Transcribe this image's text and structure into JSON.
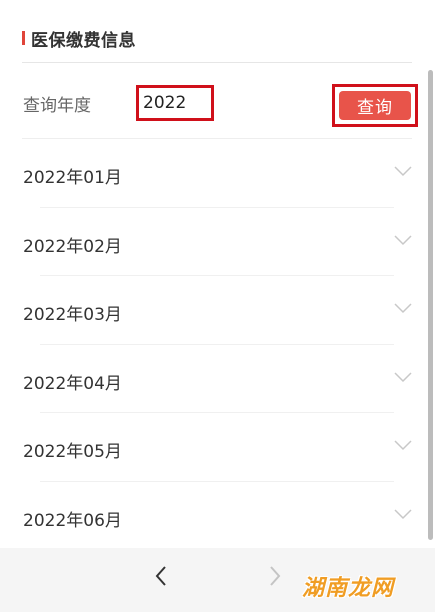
{
  "section": {
    "title": "医保缴费信息",
    "accent_color": "#e0453a"
  },
  "query": {
    "label": "查询年度",
    "year_value": "2022",
    "button_label": "查询",
    "button_color": "#e8544a",
    "highlight_color": "#d0101a"
  },
  "months": [
    {
      "label": "2022年01月",
      "icon": "chevron-down-icon"
    },
    {
      "label": "2022年02月",
      "icon": "chevron-down-icon"
    },
    {
      "label": "2022年03月",
      "icon": "chevron-down-icon"
    },
    {
      "label": "2022年04月",
      "icon": "chevron-down-icon"
    },
    {
      "label": "2022年05月",
      "icon": "chevron-down-icon"
    },
    {
      "label": "2022年06月",
      "icon": "chevron-down-icon"
    }
  ],
  "nav": {
    "back_icon": "chevron-left-icon",
    "forward_icon": "chevron-right-icon"
  },
  "watermark": {
    "text": "湖南龙网",
    "color": "#f09d24"
  }
}
